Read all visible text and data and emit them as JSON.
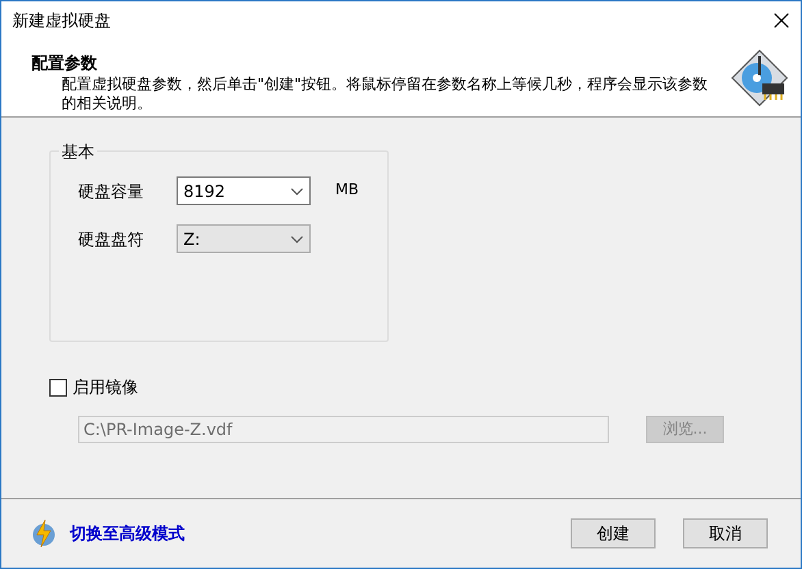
{
  "window": {
    "title": "新建虚拟硬盘"
  },
  "header": {
    "title": "配置参数",
    "description": "配置虚拟硬盘参数，然后单击\"创建\"按钮。将鼠标停留在参数名称上等候几秒，程序会显示该参数的相关说明。"
  },
  "group": {
    "title": "基本",
    "fields": [
      {
        "label": "硬盘容量",
        "kind": "editable",
        "value": "8192",
        "unit": "MB"
      },
      {
        "label": "硬盘盘符",
        "kind": "list",
        "value": "Z:"
      }
    ]
  },
  "mirror": {
    "label": "启用镜像",
    "checked": false,
    "path": "C:\\PR-Image-Z.vdf",
    "path_disabled": true,
    "browse": "浏览...",
    "browse_disabled": true
  },
  "footer": {
    "advanced_link": "切换至高级模式",
    "buttons": [
      "创建",
      "取消"
    ]
  }
}
